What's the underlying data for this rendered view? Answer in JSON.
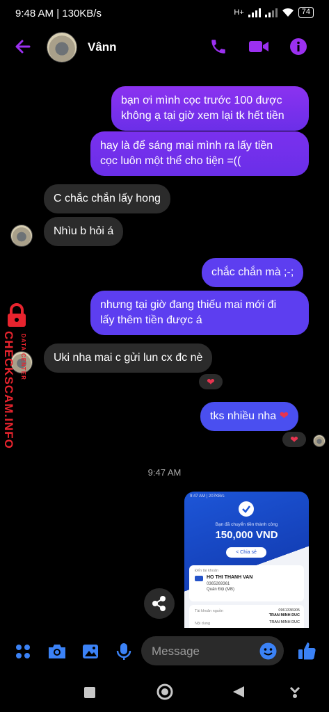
{
  "status_bar": {
    "time": "9:48 AM | 130KB/s",
    "network": "H+",
    "battery": "74"
  },
  "header": {
    "contact_name": "Vânn"
  },
  "messages": {
    "m1": [
      "bạn ơi mình cọc trước 100 được",
      "không ạ tại giờ xem lại tk hết tiền"
    ],
    "m2": [
      "hay là để sáng mai mình ra lấy tiền",
      "cọc luôn một thể cho tiện =(("
    ],
    "m3": "C chắc chắn lấy hong",
    "m4": "Nhìu b hỏi á",
    "m5": "chắc chắn mà ;-;",
    "m6": [
      "nhưng tại giờ đang thiếu mai mới đi",
      "lấy thêm tiền được á"
    ],
    "m7": "Uki nha mai c gửi lun cx đc nè",
    "m8": "tks nhiều nha",
    "timestamp": "9:47 AM"
  },
  "receipt": {
    "status_line": "9:47 AM | 207KB/s",
    "subtitle": "Bạn đã chuyển tiền thành công",
    "amount": "150,000 VND",
    "share_label": "Chia sẻ",
    "to_label": "Đến tài khoản",
    "to_name": "HO THI THANH VAN",
    "to_account": "0365269361",
    "to_bank": "Quân Đội (MB)",
    "src_label": "Tài khoản nguồn",
    "src_account": "0961336905",
    "src_name": "TRAN MINH DUC",
    "content_label": "Nội dung",
    "content_value": "TRAN MINH DUC"
  },
  "composer": {
    "placeholder": "Message"
  },
  "watermark": {
    "main": "CHECKSCAM.INFO",
    "sub": "DATA CENTER"
  },
  "colors": {
    "accent": "#8b32f0",
    "bubble_in": "#2b2b2b",
    "composer_icon": "#3b82f6",
    "watermark": "#e8242e"
  }
}
